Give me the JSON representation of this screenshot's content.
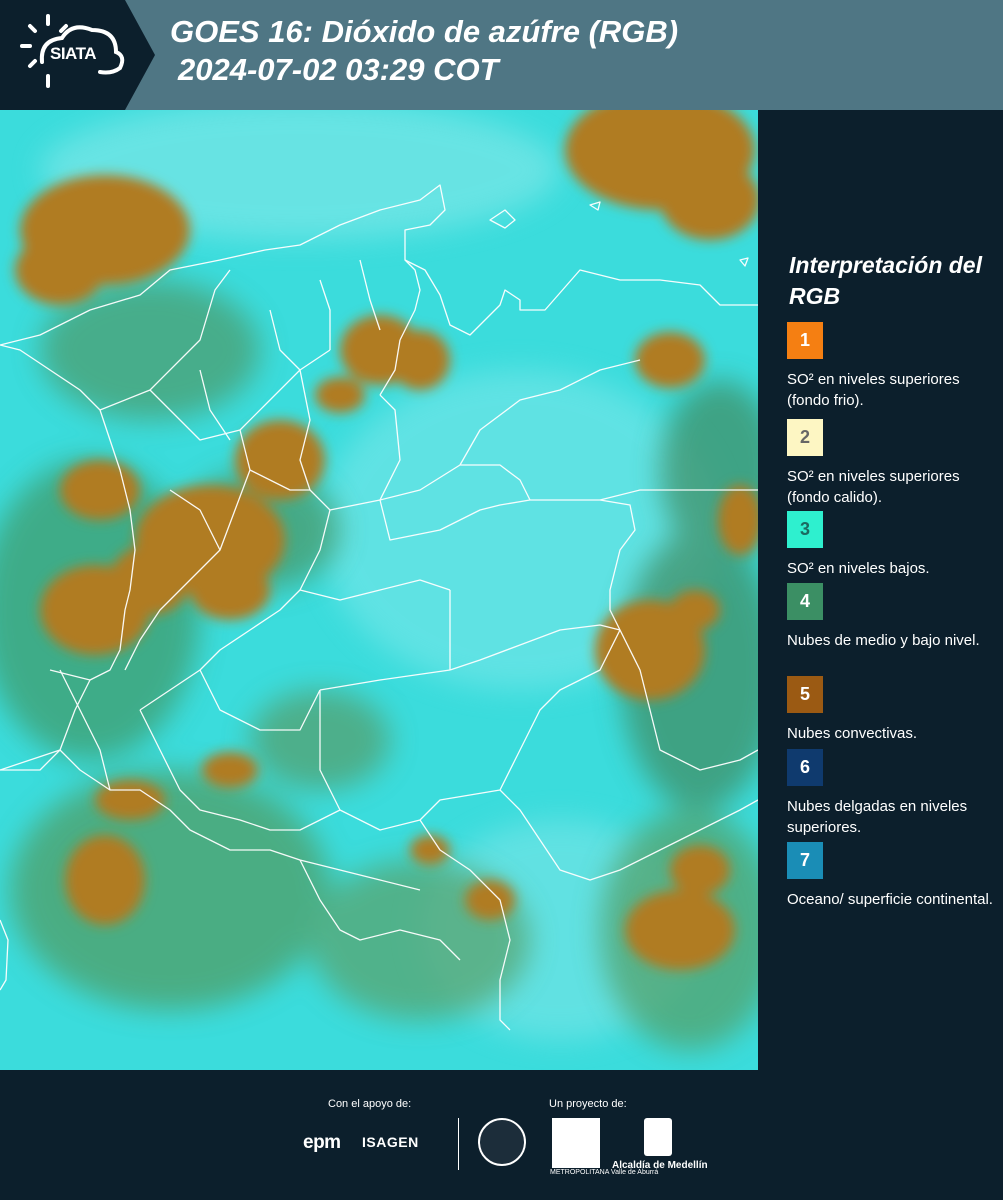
{
  "header": {
    "logo_text": "SIATA",
    "title_line1": "GOES 16: Dióxido de azúfre (RGB)",
    "title_line2": "2024-07-02 03:29 COT",
    "background_color": "#4f7684"
  },
  "map": {
    "description_icon": "satellite-rgb-map",
    "base_color": "#3bdcdc",
    "cloud_color": "#b07c22",
    "border_color": "#ffffff"
  },
  "legend": {
    "title": "Interpretación del RGB",
    "items": [
      {
        "number": "1",
        "color": "#f57f12",
        "text_color": "#ffffff",
        "label": "SO² en niveles superiores (fondo frio)."
      },
      {
        "number": "2",
        "color": "#fdf6c3",
        "text_color": "#666666",
        "label": "SO² en niveles superiores (fondo calido)."
      },
      {
        "number": "3",
        "color": "#2ef0cf",
        "text_color": "#1b6a60",
        "label": "SO² en niveles bajos."
      },
      {
        "number": "4",
        "color": "#3b8f64",
        "text_color": "#ffffff",
        "label": "Nubes de medio y bajo nivel."
      },
      {
        "number": "5",
        "color": "#9b5a13",
        "text_color": "#ffffff",
        "label": "Nubes convectivas."
      },
      {
        "number": "6",
        "color": "#0f3a6e",
        "text_color": "#ffffff",
        "label": "Nubes delgadas en niveles superiores."
      },
      {
        "number": "7",
        "color": "#1a8db6",
        "text_color": "#ffffff",
        "label": "Oceano/ superficie continental."
      }
    ]
  },
  "footer": {
    "support_label": "Con el apoyo de:",
    "project_label": "Un proyecto de:",
    "sponsors": [
      "epm",
      "ISAGEN"
    ],
    "area_text": "METROPOLITANA Valle de Aburrá",
    "alcaldia_text": "Alcaldía de Medellín"
  }
}
